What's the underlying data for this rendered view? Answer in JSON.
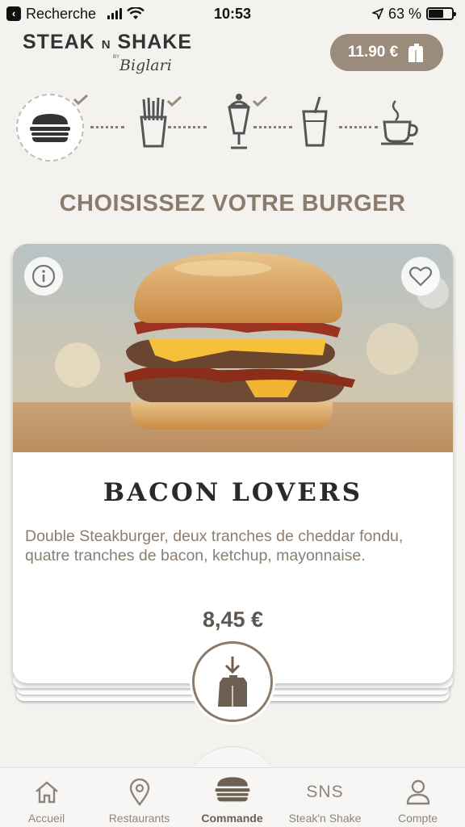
{
  "status_bar": {
    "back_label": "Recherche",
    "time": "10:53",
    "battery_text": "63 %",
    "battery_level": 0.63
  },
  "header": {
    "brand_main": "STEAK",
    "brand_n": "N",
    "brand_second": "SHAKE",
    "brand_by": "BY",
    "brand_signature": "Biglari",
    "cart_total": "11.90 €"
  },
  "steps": [
    {
      "icon": "burger-icon",
      "done": true,
      "active": true
    },
    {
      "icon": "fries-icon",
      "done": true
    },
    {
      "icon": "shake-icon",
      "done": true
    },
    {
      "icon": "drink-icon",
      "done": false
    },
    {
      "icon": "coffee-icon",
      "done": false
    }
  ],
  "page_title": "CHOISISSEZ VOTRE BURGER",
  "product": {
    "name": "BACON LOVERS",
    "description": "Double Steakburger, deux tranches de cheddar fondu, quatre tranches de bacon, ketchup, mayonnaise.",
    "price": "8,45 €",
    "favorite": false
  },
  "tabbar": {
    "items": [
      {
        "label": "Accueil",
        "icon": "home-icon"
      },
      {
        "label": "Restaurants",
        "icon": "location-pin-icon"
      },
      {
        "label": "Commande",
        "icon": "burger-icon",
        "active": true
      },
      {
        "label": "Steak'n Shake",
        "icon": "sns-logo-icon",
        "icon_text": "SNS"
      },
      {
        "label": "Compte",
        "icon": "user-icon"
      }
    ]
  },
  "colors": {
    "brand": "#9a8b7a",
    "background": "#f4f2ef",
    "title": "#8a7b6a"
  }
}
